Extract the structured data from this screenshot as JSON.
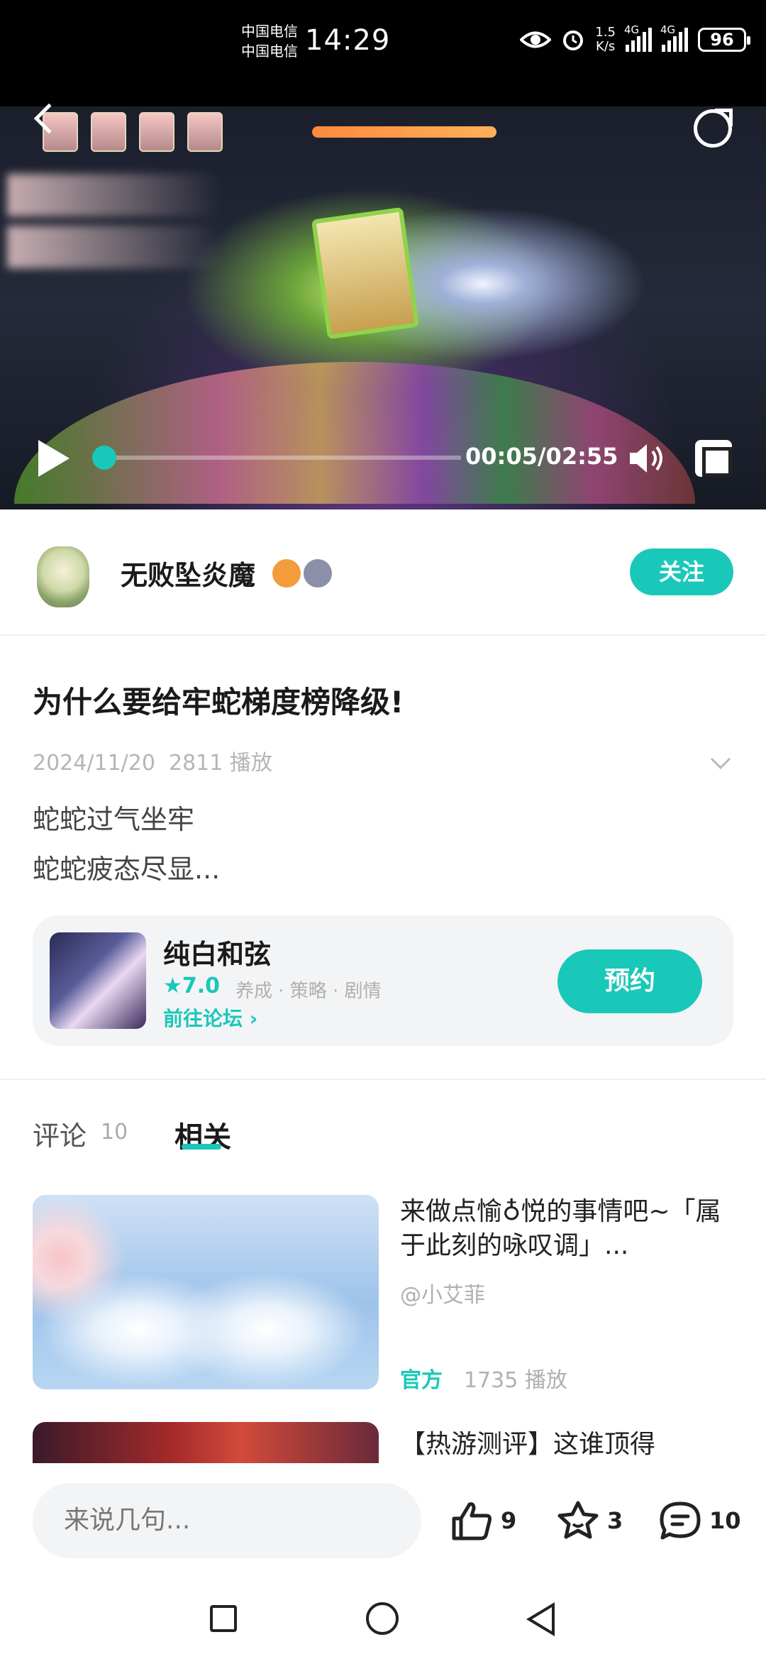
{
  "status_bar": {
    "carrier_1": "中国电信",
    "carrier_2": "中国电信",
    "time": "14:29",
    "net_speed_value": "1.5",
    "net_speed_unit": "K/s",
    "signal_1_label": "4G",
    "signal_2_label": "4G",
    "battery": "96",
    "icons": [
      "eye-icon",
      "alarm-icon",
      "signal-icon",
      "battery-icon"
    ]
  },
  "video": {
    "current_time": "00:05",
    "duration": "02:55",
    "time_display": "00:05/02:55",
    "progress_fraction": 0.03,
    "icons": [
      "back-icon",
      "share-icon",
      "play-icon",
      "volume-icon",
      "fullscreen-icon"
    ]
  },
  "author": {
    "name": "无败坠炎魔",
    "follow_label": "关注"
  },
  "post": {
    "title": "为什么要给牢蛇梯度榜降级!",
    "date": "2024/11/20",
    "plays": "2811 播放",
    "body_line_1": "蛇蛇过气坐牢",
    "body_line_2": "蛇蛇疲态尽显..."
  },
  "game": {
    "name": "纯白和弦",
    "rating": "★7.0",
    "tags": "养成 · 策略 · 剧情",
    "forum_link": "前往论坛 ›",
    "reserve_label": "预约"
  },
  "tabs": {
    "comments_label": "评论",
    "comments_count": "10",
    "related_label": "相关"
  },
  "related": [
    {
      "title": "来做点愉♁悦的事情吧~「属于此刻的咏叹调」...",
      "author": "@小艾菲",
      "tag": "官方",
      "plays": "1735 播放"
    },
    {
      "title": "【热游测评】这谁顶得"
    }
  ],
  "bottom_bar": {
    "comment_placeholder": "来说几句...",
    "like_count": "9",
    "favorite_count": "3",
    "comment_count": "10"
  },
  "colors": {
    "accent": "#19c8b8",
    "status_bar_bg": "#000000",
    "card_bg": "#f3f4f6"
  }
}
